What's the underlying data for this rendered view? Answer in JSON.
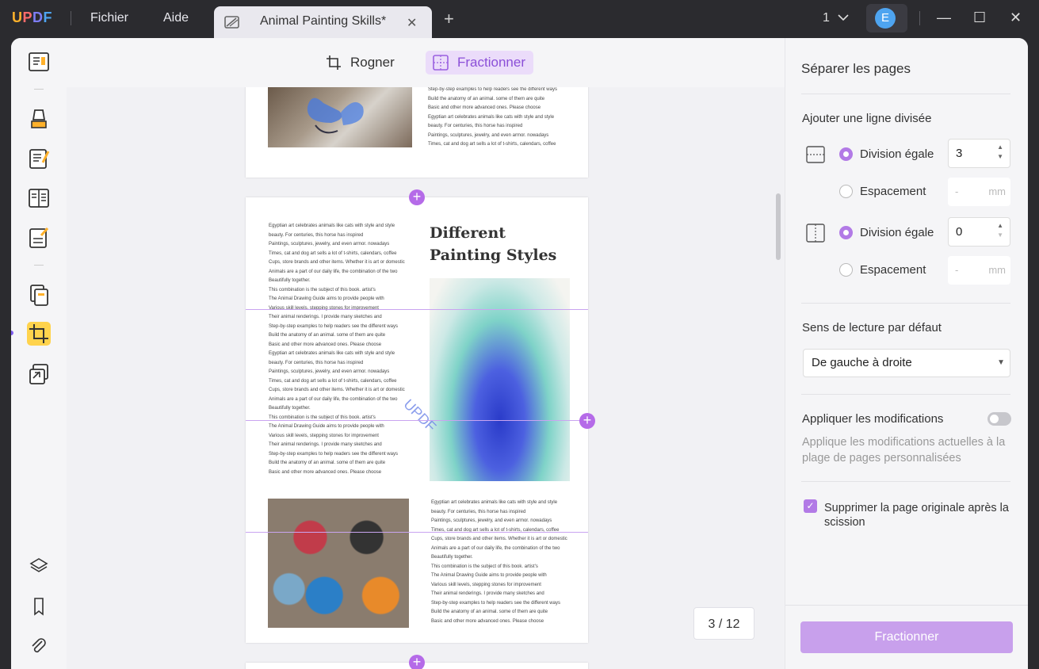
{
  "app": {
    "logo": "UPDF",
    "menu_file": "Fichier",
    "menu_help": "Aide"
  },
  "tab": {
    "title": "Animal Painting Skills*",
    "close": "✕",
    "add": "+"
  },
  "window": {
    "page_selector": "1",
    "avatar_letter": "E",
    "minimize": "—",
    "maximize": "☐",
    "close": "✕"
  },
  "toolbar": {
    "crop_label": "Rogner",
    "split_label": "Fractionner"
  },
  "document": {
    "page2_title": "Different Painting Styles",
    "watermark": "UPDF",
    "text_lines_top": [
      "Step-by-step examples to help readers see the different ways",
      "Build the anatomy of an animal. some of them are quite",
      "Basic and other more advanced ones. Please choose",
      "Egyptian art celebrates animals like cats with style and style",
      "beauty. For centuries, this horse has inspired",
      "Paintings, sculptures, jewelry, and even armor. nowadays",
      "Times, cat and dog art sells a lot of t-shirts, calendars, coffee"
    ],
    "text_lines_left": [
      "Egyptian art celebrates animals like cats with style and style",
      "beauty. For centuries, this horse has inspired",
      "Paintings, sculptures, jewelry, and even armor. nowadays",
      "Times, cat and dog art sells a lot of t-shirts, calendars, coffee",
      "Cups, store brands and other items. Whether it is art or domestic",
      "Animals are a part of our daily life, the combination of the two",
      "Beautifully together.",
      "This combination is the subject of this book. artist's",
      "The Animal Drawing Guide aims to provide people with",
      "Various skill levels, stepping stones for improvement",
      "Their animal renderings. I provide many sketches and",
      "Step-by-step examples to help readers see the different ways",
      "Build the anatomy of an animal. some of them are quite",
      "Basic and other more advanced ones. Please choose",
      "Egyptian art celebrates animals like cats with style and style",
      "beauty. For centuries, this horse has inspired",
      "Paintings, sculptures, jewelry, and even armor. nowadays",
      "Times, cat and dog art sells a lot of t-shirts, calendars, coffee",
      "Cups, store brands and other items. Whether it is art or domestic",
      "Animals are a part of our daily life, the combination of the two",
      "Beautifully together.",
      "This combination is the subject of this book. artist's",
      "The Animal Drawing Guide aims to provide people with",
      "Various skill levels, stepping stones for improvement",
      "Their animal renderings. I provide many sketches and",
      "Step-by-step examples to help readers see the different ways",
      "Build the anatomy of an animal. some of them are quite",
      "Basic and other more advanced ones. Please choose"
    ],
    "text_lines_right": [
      "Egyptian art celebrates animals like cats with style and style",
      "beauty. For centuries, this horse has inspired",
      "Paintings, sculptures, jewelry, and even armor. nowadays",
      "Times, cat and dog art sells a lot of t-shirts, calendars, coffee",
      "Cups, store brands and other items. Whether it is art or domestic",
      "Animals are a part of our daily life, the combination of the two",
      "Beautifully together.",
      "This combination is the subject of this book. artist's",
      "The Animal Drawing Guide aims to provide people with",
      "Various skill levels, stepping stones for improvement",
      "Their animal renderings. I provide many sketches and",
      "Step-by-step examples to help readers see the different ways",
      "Build the anatomy of an animal. some of them are quite",
      "Basic and other more advanced ones. Please choose"
    ],
    "page_indicator": "3 / 12"
  },
  "panel": {
    "title": "Séparer les pages",
    "add_line_label": "Ajouter une ligne divisée",
    "h_equal_label": "Division égale",
    "h_equal_value": "3",
    "h_spacing_label": "Espacement",
    "h_spacing_placeholder": "-",
    "h_spacing_unit": "mm",
    "v_equal_label": "Division égale",
    "v_equal_value": "0",
    "v_spacing_label": "Espacement",
    "v_spacing_placeholder": "-",
    "v_spacing_unit": "mm",
    "reading_label": "Sens de lecture par défaut",
    "reading_value": "De gauche à droite",
    "apply_label": "Appliquer les modifications",
    "apply_desc": "Applique les modifications actuelles à la plage de pages personnalisées",
    "apply_on": false,
    "delete_label": "Supprimer la page originale après la scission",
    "delete_checked": true,
    "submit_label": "Fractionner"
  },
  "colors": {
    "accent": "#b27ae6",
    "accent_light": "#c8a0ec",
    "dark": "#2b2b2f"
  }
}
